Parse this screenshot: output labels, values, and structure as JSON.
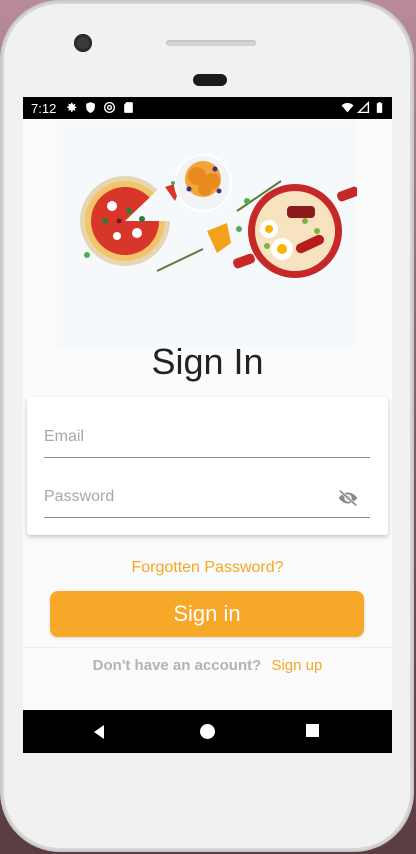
{
  "status_bar": {
    "time": "7:12",
    "icons_left": [
      "gear-icon",
      "shield-icon",
      "at-sign-icon",
      "sd-card-icon"
    ],
    "icons_right": [
      "wifi-icon",
      "cell-signal-icon",
      "battery-icon"
    ]
  },
  "hero": {
    "image_name": "food-illustration"
  },
  "title": "Sign In",
  "form": {
    "email_placeholder": "Email",
    "email_value": "",
    "password_placeholder": "Password",
    "password_value": "",
    "password_toggle_icon": "eye-off-icon"
  },
  "forgot_password": "Forgotten Password?",
  "signin_button": "Sign in",
  "signup": {
    "prompt": "Don't have an account?",
    "link": "Sign up"
  },
  "colors": {
    "accent": "#f8a829",
    "link": "#f5a623",
    "muted_text": "#b3b3b3"
  },
  "nav_bar": {
    "icons": [
      "back-icon",
      "home-icon",
      "recents-icon"
    ]
  }
}
